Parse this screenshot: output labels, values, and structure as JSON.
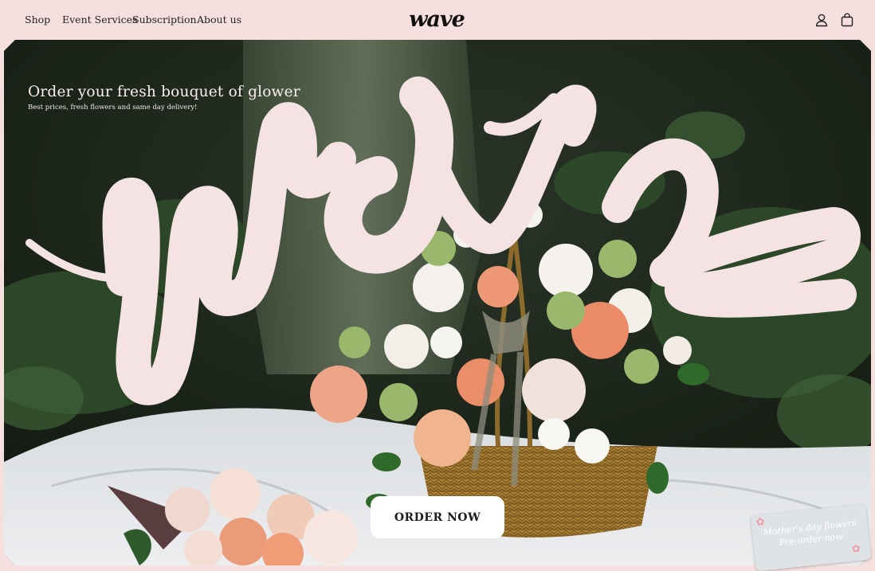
{
  "nav": {
    "links": [
      "Shop",
      "Event Services",
      "Subscription",
      "About us"
    ],
    "logo": "wave"
  },
  "icons": {
    "account": "user-icon",
    "cart": "shopping-bag-icon",
    "ticket_decoration": "flower-icon"
  },
  "hero": {
    "title": "Order your fresh bouquet of glower",
    "subtitle": "Best prices, fresh flowers and same day delivery!",
    "order_button": "ORDER NOW",
    "ticket": {
      "line1": "Mother's day flowers",
      "line2": "Pre-order now"
    }
  },
  "colors": {
    "page_background": "#f5dfdf",
    "wordmark": "#f5e3e3",
    "button_background": "#ffffff"
  }
}
